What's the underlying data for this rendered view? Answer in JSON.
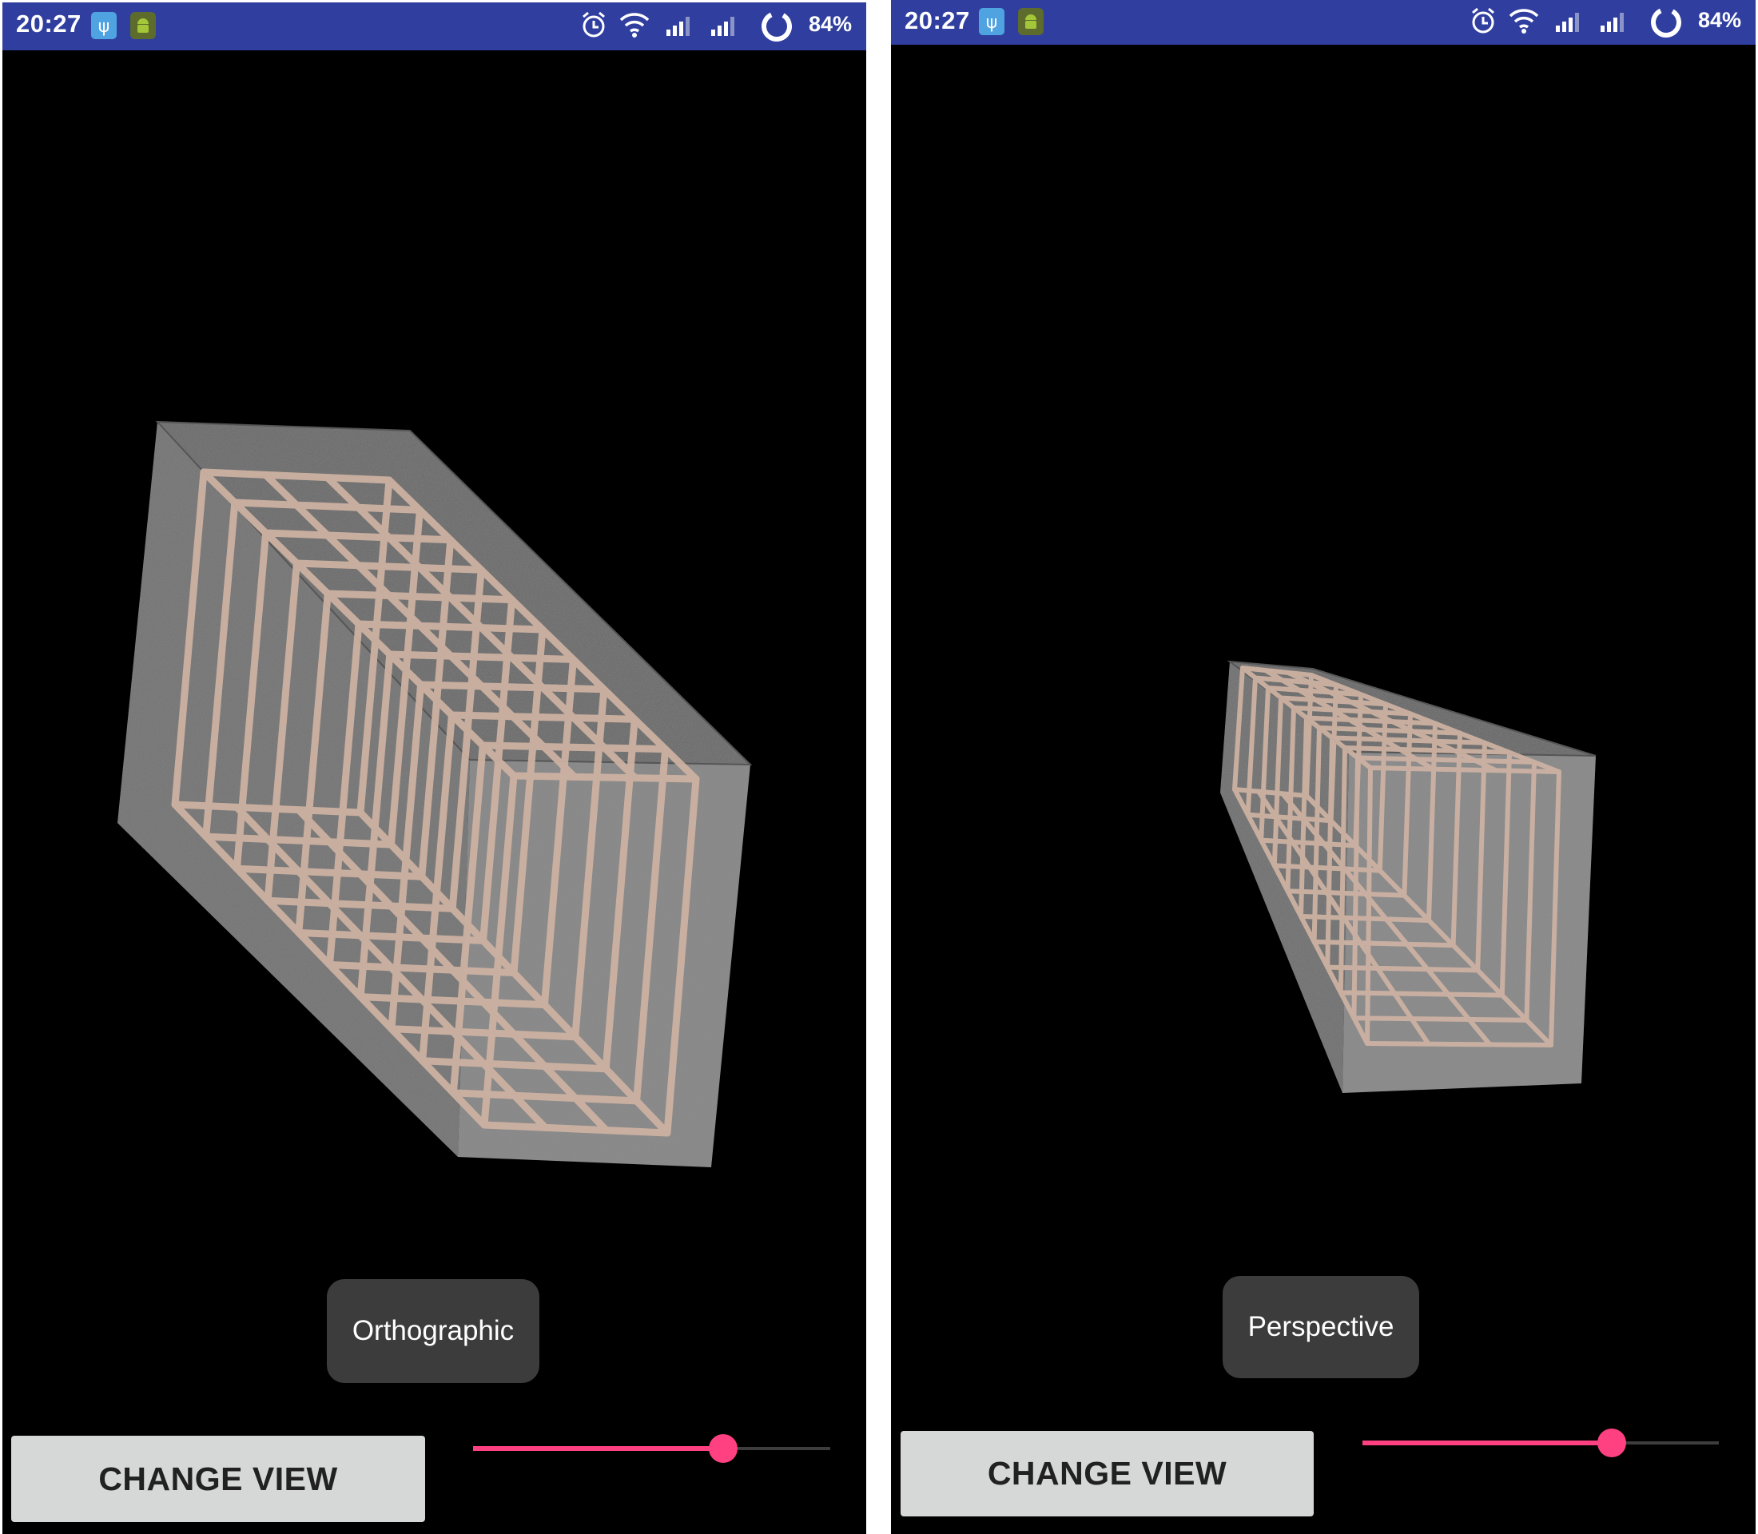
{
  "screens": [
    {
      "status_bar": {
        "time": "20:27",
        "battery": "84%",
        "icons": [
          "usb-icon",
          "android-debug-icon",
          "alarm-icon",
          "wifi-icon",
          "signal-icon",
          "signal-icon",
          "battery-ring-icon"
        ]
      },
      "toast": "Orthographic",
      "change_view_label": "CHANGE VIEW",
      "slider_value": 0.7,
      "colors": {
        "status_bar": "#303f9f",
        "accent": "#ff4081",
        "background": "#000000"
      }
    },
    {
      "status_bar": {
        "time": "20:27",
        "battery": "84%",
        "icons": [
          "usb-icon",
          "android-debug-icon",
          "alarm-icon",
          "wifi-icon",
          "signal-icon",
          "signal-icon",
          "battery-ring-icon"
        ]
      },
      "toast": "Perspective",
      "change_view_label": "CHANGE VIEW",
      "slider_value": 0.7,
      "colors": {
        "status_bar": "#303f9f",
        "accent": "#ff4081",
        "background": "#000000"
      }
    }
  ]
}
